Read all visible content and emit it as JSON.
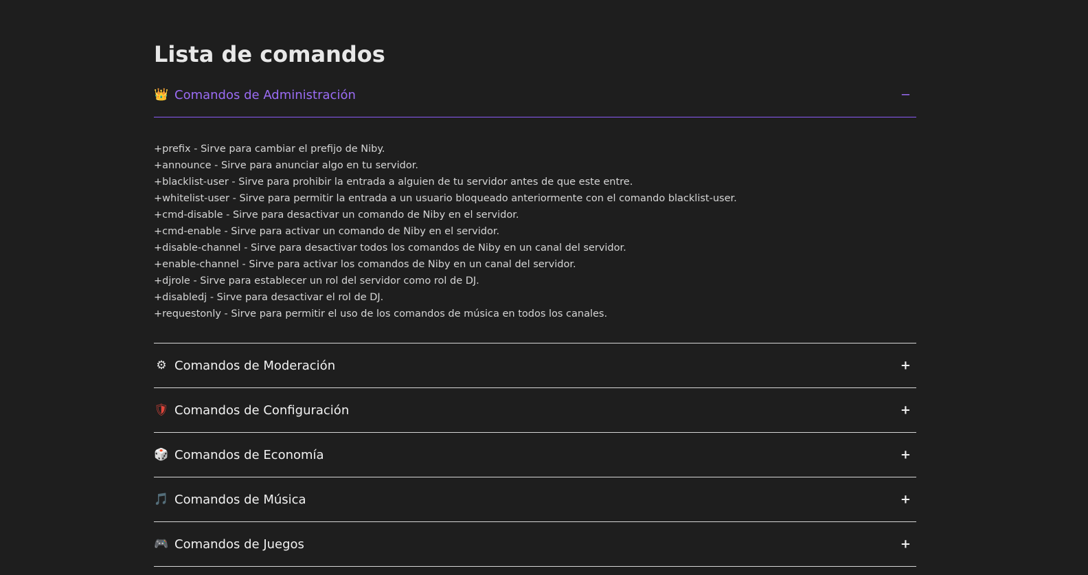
{
  "page": {
    "title": "Lista de comandos"
  },
  "sections": [
    {
      "icon": "crown-icon",
      "glyph": "👑",
      "title": "Comandos de Administración",
      "toggle": "−",
      "expanded": true,
      "commands": [
        "+prefix - Sirve para cambiar el prefijo de Niby.",
        "+announce - Sirve para anunciar algo en tu servidor.",
        "+blacklist-user - Sirve para prohibir la entrada a alguien de tu servidor antes de que este entre.",
        "+whitelist-user - Sirve para permitir la entrada a un usuario bloqueado anteriormente con el comando blacklist-user.",
        "+cmd-disable - Sirve para desactivar un comando de Niby en el servidor.",
        "+cmd-enable - Sirve para activar un comando de Niby en el servidor.",
        "+disable-channel - Sirve para desactivar todos los comandos de Niby en un canal del servidor.",
        "+enable-channel - Sirve para activar los comandos de Niby en un canal del servidor.",
        "+djrole - Sirve para establecer un rol del servidor como rol de DJ.",
        "+disabledj - Sirve para desactivar el rol de DJ.",
        "+requestonly - Sirve para permitir el uso de los comandos de música en todos los canales."
      ]
    },
    {
      "icon": "gear-icon",
      "glyph": "⚙",
      "title": "Comandos de Moderación",
      "toggle": "+",
      "expanded": false
    },
    {
      "icon": "shield-icon",
      "glyph": "🛡",
      "title": "Comandos de Configuración",
      "toggle": "+",
      "expanded": false
    },
    {
      "icon": "dice-icon",
      "glyph": "🎲",
      "title": "Comandos de Economía",
      "toggle": "+",
      "expanded": false
    },
    {
      "icon": "music-icon",
      "glyph": "🎵",
      "title": "Comandos de Música",
      "toggle": "+",
      "expanded": false
    },
    {
      "icon": "gamepad-icon",
      "glyph": "🎮",
      "title": "Comandos de Juegos",
      "toggle": "+",
      "expanded": false
    }
  ],
  "colors": {
    "background": "#1e1e1e",
    "accent": "#9b6cf5",
    "text": "#e6e6e6",
    "divider": "#d8d8d8"
  }
}
